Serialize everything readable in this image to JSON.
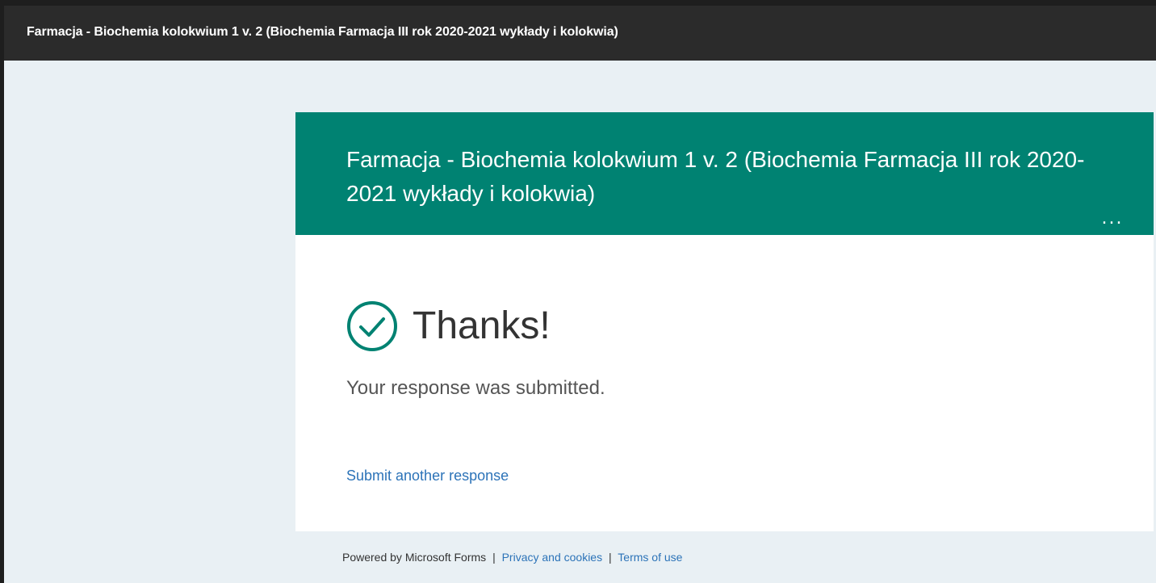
{
  "window": {
    "title": "Farmacja - Biochemia kolokwium 1 v. 2 (Biochemia Farmacja III rok 2020-2021 wykłady i kolokwia)"
  },
  "form": {
    "title": "Farmacja - Biochemia kolokwium 1 v. 2 (Biochemia Farmacja III rok 2020-2021 wykłady i kolokwia)",
    "more_icon": "more-horizontal-icon",
    "more_label": "..."
  },
  "confirmation": {
    "icon": "check-circle-icon",
    "heading": "Thanks!",
    "message": "Your response was submitted.",
    "submit_another": "Submit another response"
  },
  "footer": {
    "powered_by": "Powered by Microsoft Forms",
    "separator": "|",
    "privacy": "Privacy and cookies",
    "terms": "Terms of use"
  },
  "colors": {
    "header_bg": "#008272",
    "page_bg": "#e9f0f4",
    "titlebar_bg": "#2b2b2b",
    "link": "#2c73b8"
  }
}
